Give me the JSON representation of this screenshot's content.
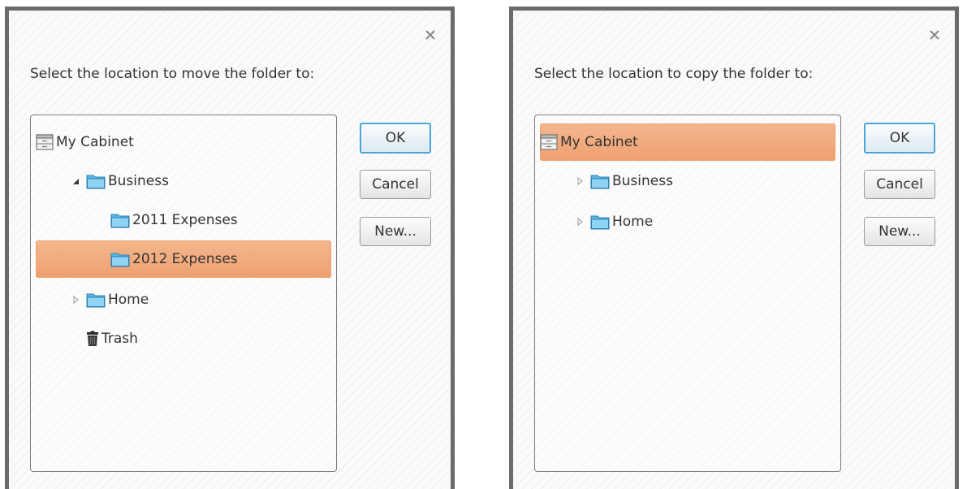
{
  "move_dialog": {
    "prompt": "Select the location to move the folder to:",
    "tree": {
      "root": "My Cabinet",
      "business": "Business",
      "expenses_2011": "2011 Expenses",
      "expenses_2012": "2012 Expenses",
      "home": "Home",
      "trash": "Trash"
    },
    "selected": "2012 Expenses",
    "buttons": {
      "ok": "OK",
      "cancel": "Cancel",
      "new": "New..."
    }
  },
  "copy_dialog": {
    "prompt": "Select the location to copy the folder to:",
    "tree": {
      "root": "My Cabinet",
      "business": "Business",
      "home": "Home"
    },
    "selected": "My Cabinet",
    "buttons": {
      "ok": "OK",
      "cancel": "Cancel",
      "new": "New..."
    }
  },
  "icons": {
    "close": "close-icon",
    "cabinet": "cabinet-icon",
    "folder": "folder-icon",
    "trash": "trash-icon",
    "expanded": "expanded-triangle-icon",
    "collapsed": "collapsed-triangle-icon"
  },
  "colors": {
    "selection": "#f0a877",
    "ok_border": "#4aa6d6",
    "folder": "#5ab8e8",
    "frame": "#6b6b6b"
  }
}
